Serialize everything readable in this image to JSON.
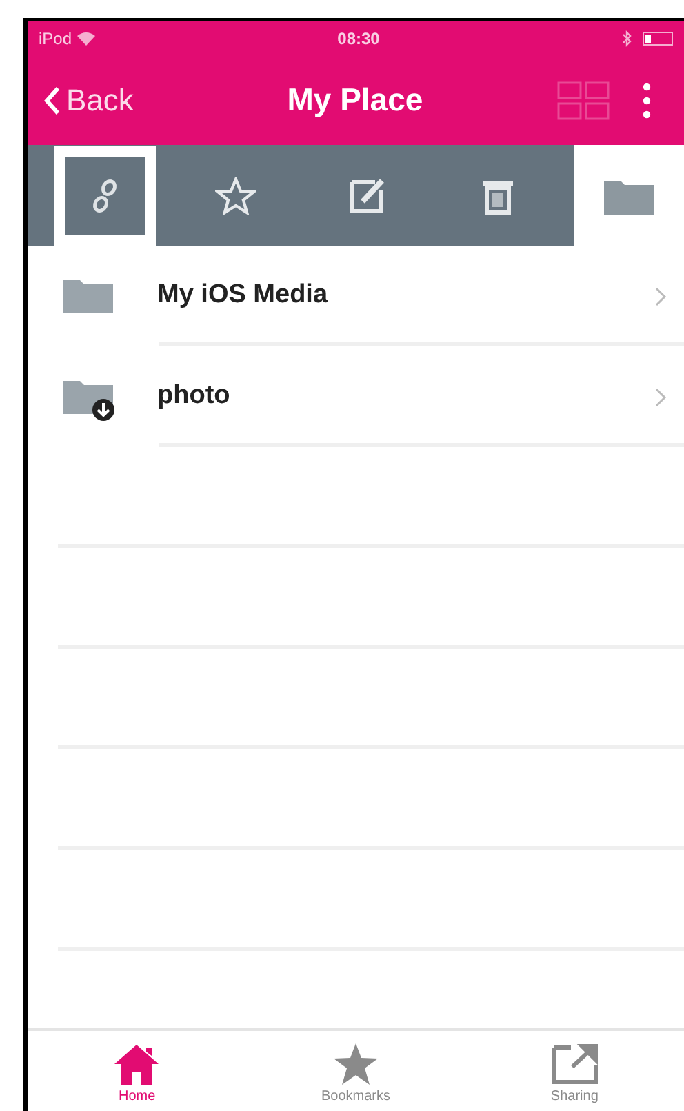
{
  "status_bar": {
    "carrier": "iPod",
    "time": "08:30"
  },
  "nav_bar": {
    "back": "Back",
    "title": "My Place"
  },
  "toolbar": [
    {
      "kind": "link",
      "selected": true
    },
    {
      "kind": "star",
      "selected": false
    },
    {
      "kind": "edit",
      "selected": false
    },
    {
      "kind": "trash",
      "selected": false
    }
  ],
  "folder_tab": {
    "selected": true
  },
  "rows": [
    {
      "name": "My iOS Media",
      "kind": "folder"
    },
    {
      "name": "photo",
      "kind": "download-folder"
    }
  ],
  "tab_bar": [
    {
      "label": "Home",
      "kind": "home",
      "selected": true
    },
    {
      "label": "Bookmarks",
      "kind": "star",
      "selected": false
    },
    {
      "label": "Sharing",
      "kind": "share",
      "selected": false
    }
  ]
}
